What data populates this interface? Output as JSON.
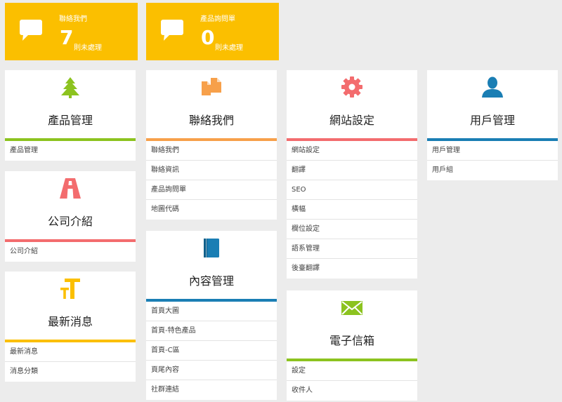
{
  "colors": {
    "stat_bg": "#fbbf00",
    "green": "#8cc31f",
    "orange": "#f7a04a",
    "red": "#f36c6e",
    "blue": "#1a7eb4",
    "yellow": "#fbbf00"
  },
  "stats": [
    {
      "title": "聯絡我們",
      "count": "7",
      "unit": "則未處理",
      "icon": "speech-bubble-icon"
    },
    {
      "title": "產品詢問單",
      "count": "0",
      "unit": "則未處理",
      "icon": "speech-bubble-icon"
    }
  ],
  "cards": {
    "product": {
      "title": "產品管理",
      "icon": "tree-icon",
      "items": [
        "產品管理"
      ]
    },
    "company": {
      "title": "公司介紹",
      "icon": "road-icon",
      "items": [
        "公司介紹"
      ]
    },
    "news": {
      "title": "最新消息",
      "icon": "text-size-icon",
      "items": [
        "最新消息",
        "消息分類"
      ]
    },
    "contact": {
      "title": "聯絡我們",
      "icon": "documents-icon",
      "items": [
        "聯絡我們",
        "聯絡資訊",
        "產品詢問單",
        "地圖代碼"
      ]
    },
    "content": {
      "title": "內容管理",
      "icon": "book-icon",
      "items": [
        "首頁大圖",
        "首頁-特色產品",
        "首頁-C區",
        "頁尾內容",
        "社群連結"
      ]
    },
    "site": {
      "title": "網站設定",
      "icon": "gear-icon",
      "items": [
        "網站設定",
        "翻譯",
        "SEO",
        "橫幅",
        "欄位設定",
        "語系管理",
        "後臺翻譯"
      ]
    },
    "email": {
      "title": "電子信箱",
      "icon": "envelope-icon",
      "items": [
        "設定",
        "收件人"
      ]
    },
    "users": {
      "title": "用戶管理",
      "icon": "user-icon",
      "items": [
        "用戶管理",
        "用戶組"
      ]
    }
  }
}
